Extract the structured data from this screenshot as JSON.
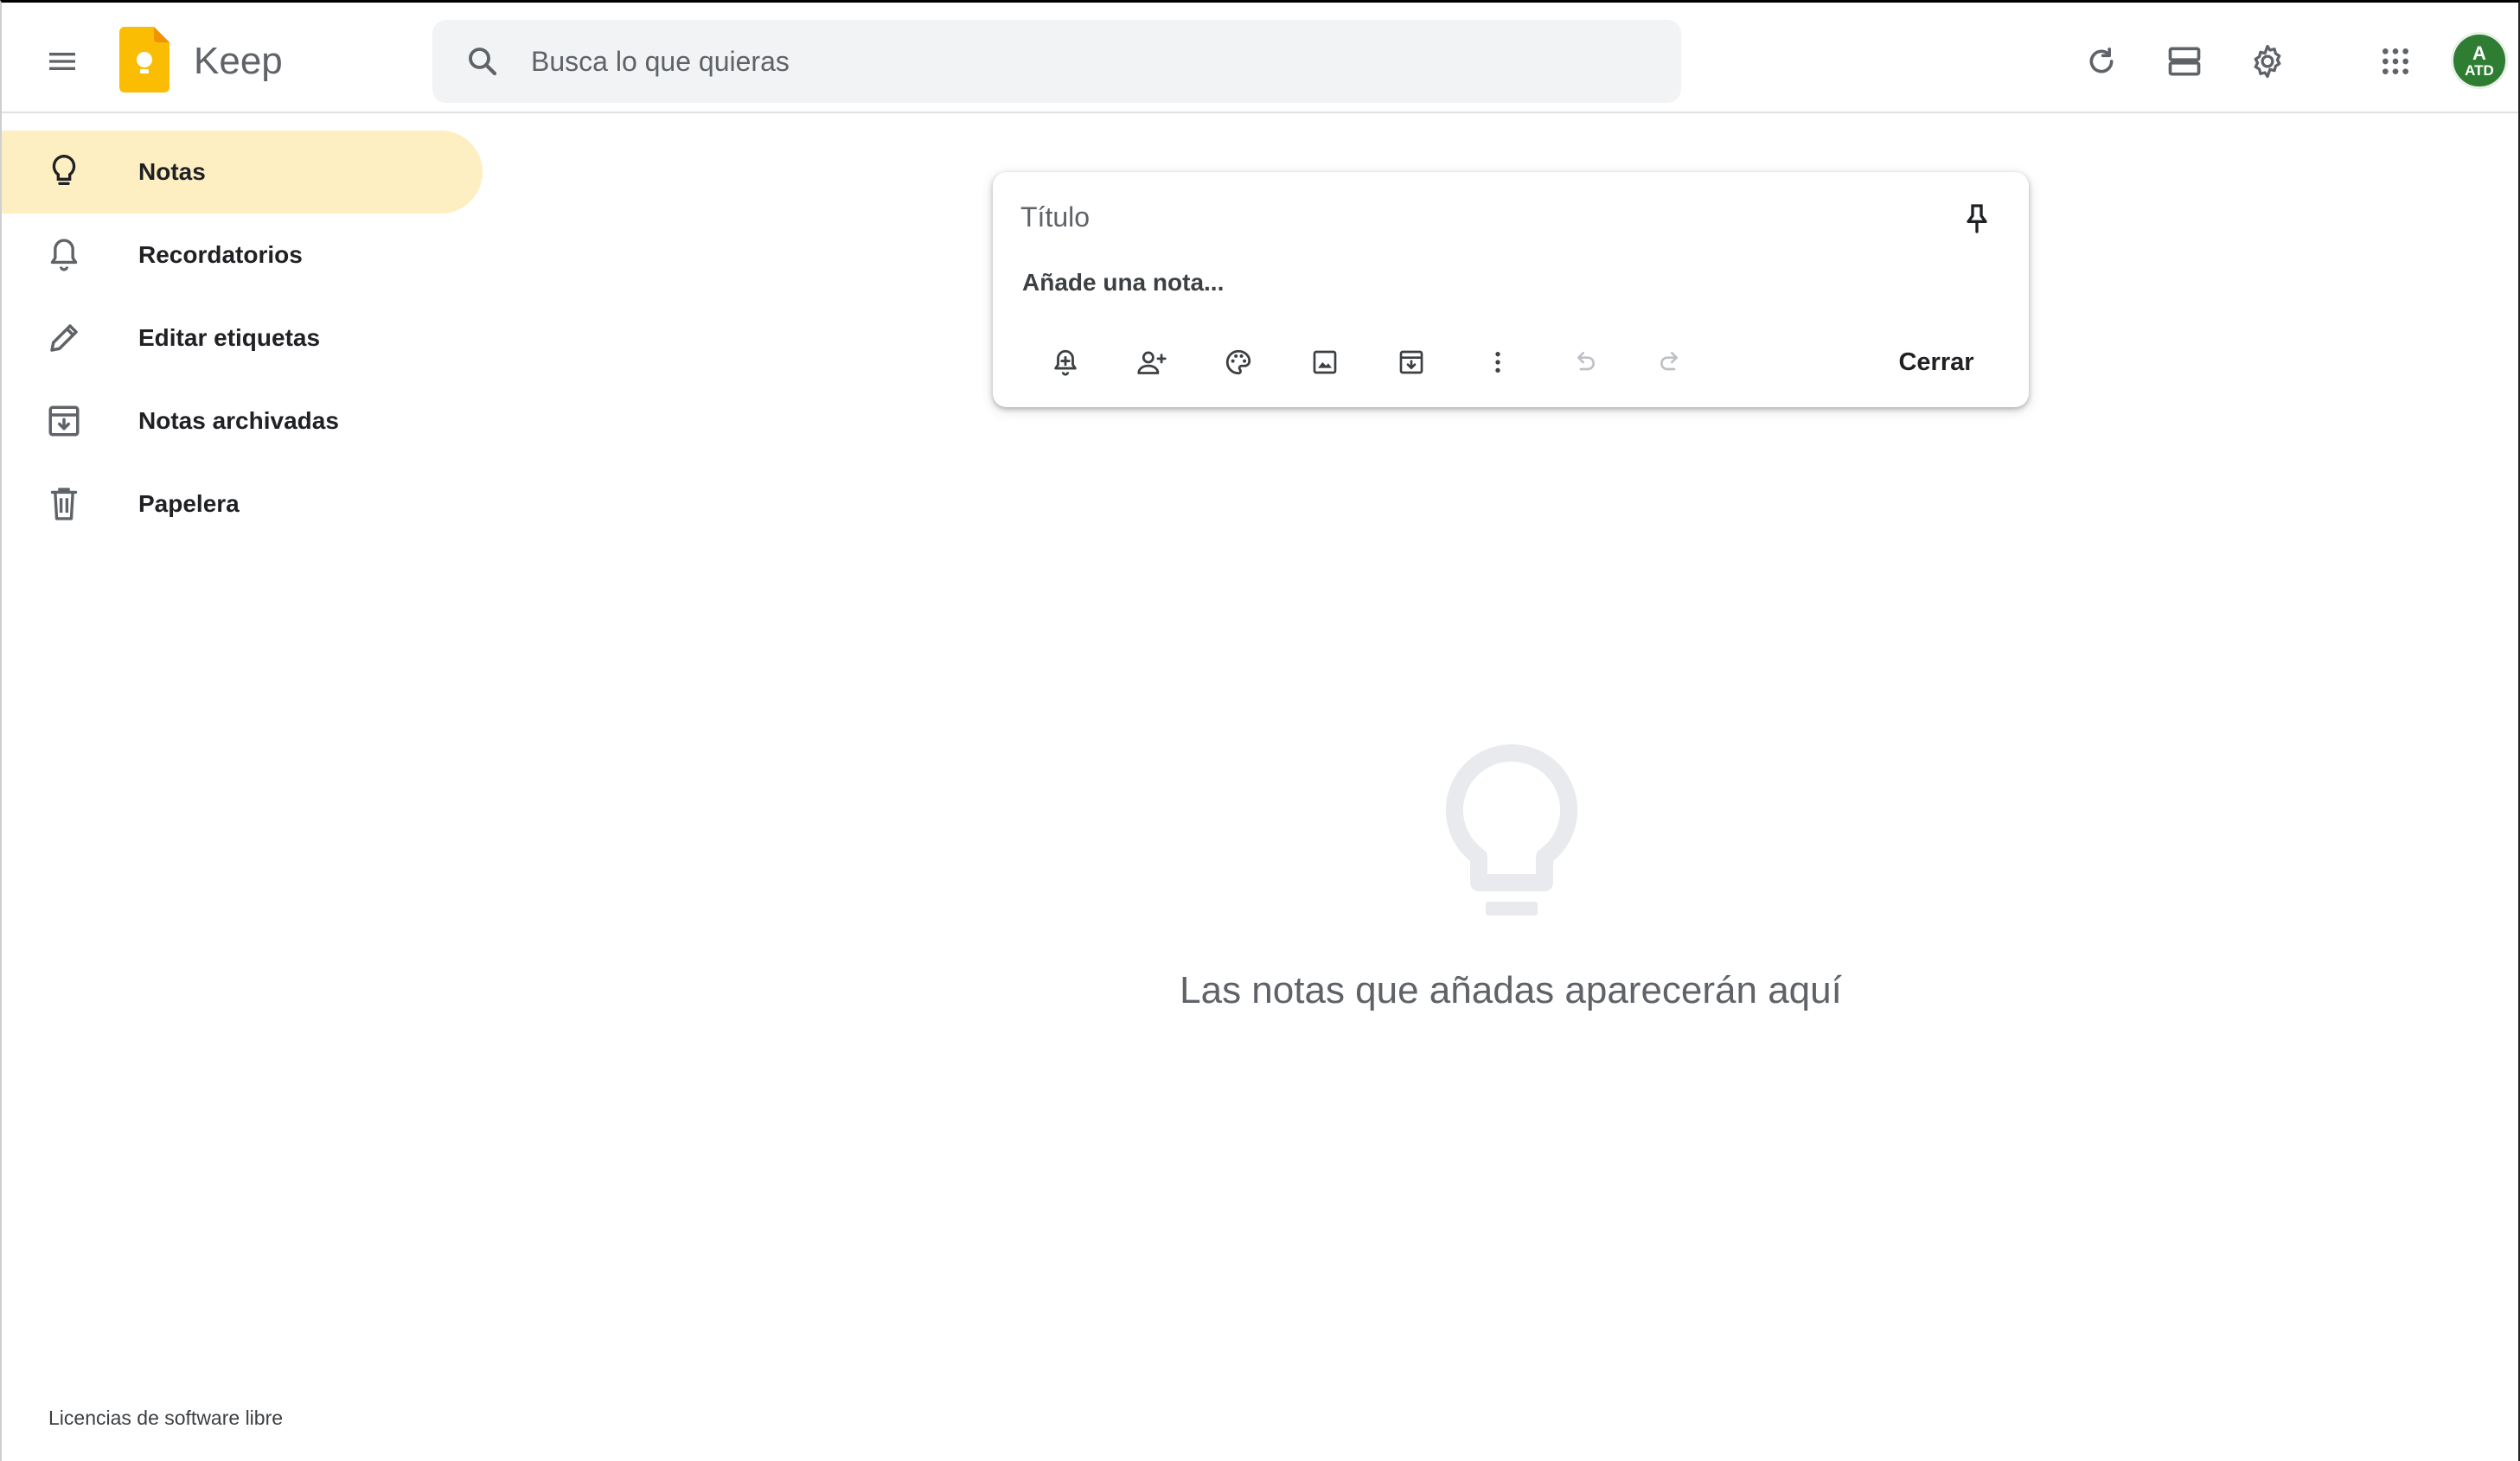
{
  "app": {
    "title": "Keep",
    "brand_color": "#fbbc04"
  },
  "search": {
    "placeholder": "Busca lo que quieras"
  },
  "header": {
    "avatar_initial": "A",
    "avatar_badge": "ATD",
    "avatar_color": "#2e7d32"
  },
  "sidebar": {
    "items": [
      {
        "label": "Notas",
        "icon": "lightbulb-icon",
        "active": true
      },
      {
        "label": "Recordatorios",
        "icon": "bell-icon",
        "active": false
      },
      {
        "label": "Editar etiquetas",
        "icon": "pencil-icon",
        "active": false
      },
      {
        "label": "Notas archivadas",
        "icon": "archive-icon",
        "active": false
      },
      {
        "label": "Papelera",
        "icon": "trash-icon",
        "active": false
      }
    ],
    "active_color": "#feefc3",
    "footer_link": "Licencias de software libre"
  },
  "composer": {
    "title_placeholder": "Título",
    "note_placeholder": "Añade una nota...",
    "close_label": "Cerrar"
  },
  "empty_state": {
    "message": "Las notas que añadas aparecerán aquí"
  }
}
